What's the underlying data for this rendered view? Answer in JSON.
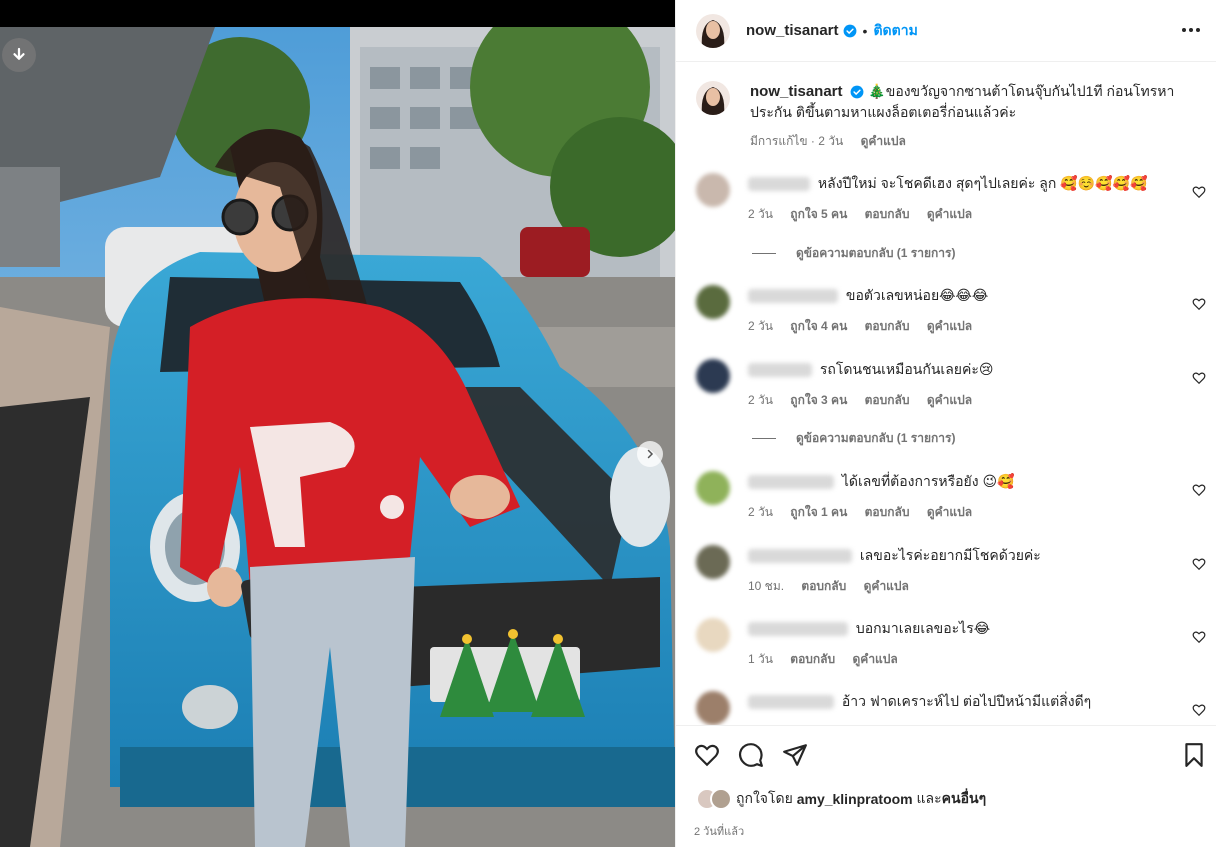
{
  "post": {
    "username": "now_tisanart",
    "follow_label": "ติดตาม",
    "dot": "•",
    "caption_text": "🎄ของขวัญจากซานต้าโดนจุ๊บกันไป1ที ก่อนโทรหาประกัน ติขึ้นตามหาแผงล็อตเตอรี่ก่อนแล้วค่ะ",
    "caption_edited": "มีการแก้ไข · 2 วัน",
    "caption_translate": "ดูคำแปล",
    "like_summary": {
      "prefix": "ถูกใจโดย",
      "user": "amy_klinpratoom",
      "middle": "และ",
      "others": "คนอื่นๆ"
    },
    "time_ago": "2 วันที่แล้ว"
  },
  "labels": {
    "reply": "ตอบกลับ",
    "translate": "ดูคำแปล"
  },
  "comments": [
    {
      "text": "หลังปีใหม่ จะโชคดีเฮง สุดๆไปเลยค่ะ ลูก 🥰☺️🥰🥰🥰",
      "time": "2 วัน",
      "likes": "ถูกใจ 5 คน",
      "avatar_color": "#c9b8ad"
    },
    {
      "text": "ขอตัวเลขหน่อย😂😂😂",
      "time": "2 วัน",
      "likes": "ถูกใจ 4 คน",
      "avatar_color": "#5a6b3e"
    },
    {
      "text": "รถโดนชนเหมือนกันเลยค่ะ😢",
      "time": "2 วัน",
      "likes": "ถูกใจ 3 คน",
      "avatar_color": "#2c3a52"
    },
    {
      "text": "ได้เลขที่ต้องการหรือยัง 😉🥰",
      "time": "2 วัน",
      "likes": "ถูกใจ 1 คน",
      "avatar_color": "#8fb25a"
    },
    {
      "text": "เลขอะไรค่ะอยากมีโชคด้วยค่ะ",
      "time": "10 ชม.",
      "likes": "",
      "avatar_color": "#6b6a55"
    },
    {
      "text": "บอกมาเลยเลขอะไร😂",
      "time": "1 วัน",
      "likes": "",
      "avatar_color": "#e8d8c0"
    },
    {
      "text": "อ้าว ฟาดเคราะห์ไป ต่อไปปีหน้ามีแต่สิ่งดีๆ",
      "time": "",
      "likes": "",
      "avatar_color": "#9c7f6a"
    }
  ],
  "view_replies": "ดูข้อความตอบกลับ (1 รายการ)",
  "icons": {
    "download": "download-icon",
    "next": "chevron-right-icon",
    "more": "more-horizontal-icon",
    "verified": "verified-badge-icon",
    "heart": "heart-icon",
    "comment": "comment-icon",
    "share": "share-icon",
    "bookmark": "bookmark-icon"
  },
  "colors": {
    "accent": "#0095f6",
    "muted": "#737373",
    "text": "#262626"
  }
}
